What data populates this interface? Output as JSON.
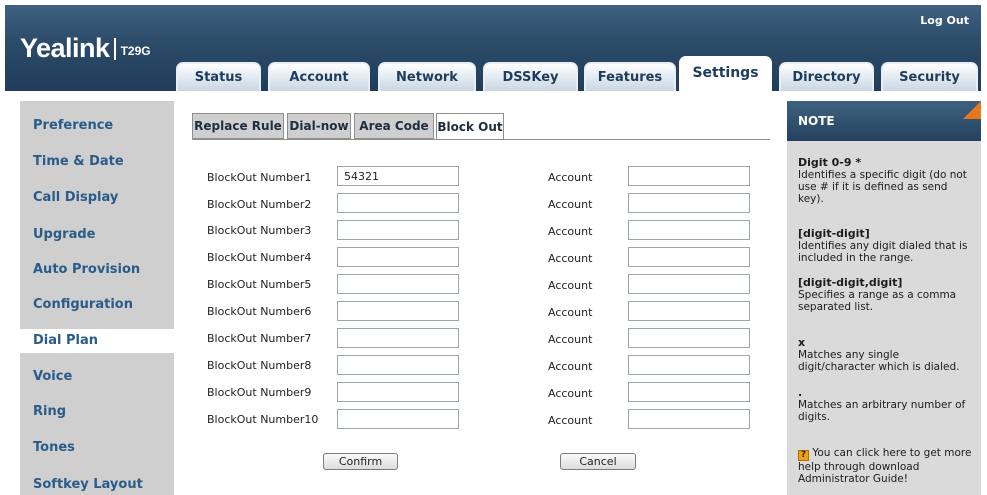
{
  "header": {
    "brand": "Yealink",
    "model": "T29G",
    "logout_label": "Log Out",
    "tabs": [
      {
        "label": "Status"
      },
      {
        "label": "Account"
      },
      {
        "label": "Network"
      },
      {
        "label": "DSSKey"
      },
      {
        "label": "Features"
      },
      {
        "label": "Settings",
        "active": true
      },
      {
        "label": "Directory"
      },
      {
        "label": "Security"
      }
    ]
  },
  "sidebar": {
    "items": [
      {
        "label": "Preference"
      },
      {
        "label": "Time & Date"
      },
      {
        "label": "Call Display"
      },
      {
        "label": "Upgrade"
      },
      {
        "label": "Auto Provision"
      },
      {
        "label": "Configuration"
      },
      {
        "label": "Dial Plan",
        "active": true
      },
      {
        "label": "Voice"
      },
      {
        "label": "Ring"
      },
      {
        "label": "Tones"
      },
      {
        "label": "Softkey Layout"
      }
    ]
  },
  "subtabs": [
    {
      "label": "Replace Rule"
    },
    {
      "label": "Dial-now"
    },
    {
      "label": "Area Code"
    },
    {
      "label": "Block Out",
      "active": true
    }
  ],
  "form": {
    "rows": [
      {
        "label": "BlockOut Number1",
        "number": "54321",
        "account_label": "Account",
        "account": ""
      },
      {
        "label": "BlockOut Number2",
        "number": "",
        "account_label": "Account",
        "account": ""
      },
      {
        "label": "BlockOut Number3",
        "number": "",
        "account_label": "Account",
        "account": ""
      },
      {
        "label": "BlockOut Number4",
        "number": "",
        "account_label": "Account",
        "account": ""
      },
      {
        "label": "BlockOut Number5",
        "number": "",
        "account_label": "Account",
        "account": ""
      },
      {
        "label": "BlockOut Number6",
        "number": "",
        "account_label": "Account",
        "account": ""
      },
      {
        "label": "BlockOut Number7",
        "number": "",
        "account_label": "Account",
        "account": ""
      },
      {
        "label": "BlockOut Number8",
        "number": "",
        "account_label": "Account",
        "account": ""
      },
      {
        "label": "BlockOut Number9",
        "number": "",
        "account_label": "Account",
        "account": ""
      },
      {
        "label": "BlockOut Number10",
        "number": "",
        "account_label": "Account",
        "account": ""
      }
    ],
    "confirm_label": "Confirm",
    "cancel_label": "Cancel"
  },
  "note": {
    "title": "NOTE",
    "entries": [
      {
        "term": "Digit 0-9 *",
        "desc": "Identifies a specific digit (do not use # if it is defined as send key)."
      },
      {
        "term": "[digit-digit]",
        "desc": "Identifies any digit dialed that is included in the range."
      },
      {
        "term": "[digit-digit,digit]",
        "desc": "Specifies a range as a comma separated list."
      },
      {
        "term": "x",
        "desc": "Matches any single digit/character which is dialed."
      },
      {
        "term": ".",
        "desc": "Matches an arbitrary number of digits."
      }
    ],
    "help_text": "You can click here to get more help through download Administrator Guide!",
    "help_icon_glyph": "?"
  },
  "colors": {
    "header": "#2b4b69",
    "nav_text": "#2a5b89",
    "nav_bg": "#cfcfcf",
    "note_bg": "#dadada",
    "note_corner": "#e8761d"
  }
}
